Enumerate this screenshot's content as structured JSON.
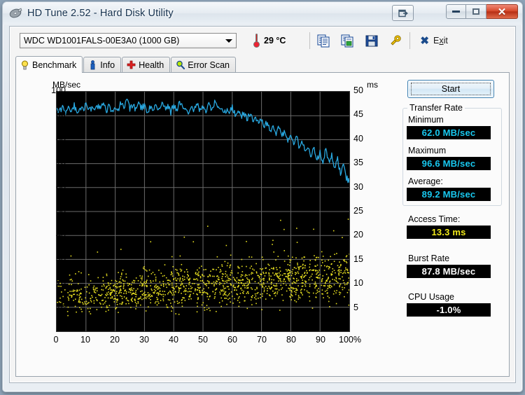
{
  "window": {
    "title": "HD Tune 2.52 - Hard Disk Utility",
    "app_icon": "hdtune-disk-icon",
    "buttons": {
      "restore_small": "restore-window-icon",
      "minimize": "minimize-icon",
      "maximize": "maximize-icon",
      "close": "✕"
    }
  },
  "toolbar": {
    "drive": {
      "selected": "WDC WD1001FALS-00E3A0 (1000 GB)",
      "options": [
        "WDC WD1001FALS-00E3A0 (1000 GB)"
      ]
    },
    "temperature": "29 °C",
    "icons": [
      {
        "name": "copy-text-icon"
      },
      {
        "name": "copy-image-icon"
      },
      {
        "name": "save-icon"
      },
      {
        "name": "options-icon"
      }
    ],
    "exit": {
      "label_before": "E",
      "label_underlined": "x",
      "label_after": "it",
      "full": "Exit"
    }
  },
  "tabs": [
    {
      "id": "benchmark",
      "label": "Benchmark",
      "icon": "bulb-icon",
      "active": true
    },
    {
      "id": "info",
      "label": "Info",
      "icon": "info-icon",
      "active": false
    },
    {
      "id": "health",
      "label": "Health",
      "icon": "health-cross-icon",
      "active": false
    },
    {
      "id": "errorscan",
      "label": "Error Scan",
      "icon": "magnifier-icon",
      "active": false
    }
  ],
  "side_panel": {
    "start_label": "Start",
    "transfer_rate": {
      "legend": "Transfer Rate",
      "minimum_label": "Minimum",
      "minimum_value": "62.0 MB/sec",
      "maximum_label": "Maximum",
      "maximum_value": "96.6 MB/sec",
      "average_label": "Average:",
      "average_value": "89.2 MB/sec"
    },
    "access_time_label": "Access Time:",
    "access_time_value": "13.3 ms",
    "burst_rate_label": "Burst Rate",
    "burst_rate_value": "87.8 MB/sec",
    "cpu_usage_label": "CPU Usage",
    "cpu_usage_value": "-1.0%"
  },
  "colors": {
    "transfer_curve": "#29a8e0",
    "access_points": "#e8e020",
    "plot_background": "#000000",
    "grid": "#6b6b6b",
    "lcd_cyan": "#18c8ef",
    "lcd_yellow": "#f2ea1a",
    "close_red": "#c0391a"
  },
  "chart_data": {
    "type": "line",
    "title": "",
    "xlabel": "100%",
    "ylabel": "MB/sec",
    "y2label": "ms",
    "xlim": [
      0,
      100
    ],
    "ylim": [
      0,
      100
    ],
    "y2lim": [
      0,
      50
    ],
    "grid": true,
    "legend": "none",
    "x_ticks": [
      "0",
      "10",
      "20",
      "30",
      "40",
      "50",
      "60",
      "70",
      "80",
      "90",
      "100%"
    ],
    "y_ticks_left": [
      "100",
      "90",
      "80",
      "70",
      "60",
      "50",
      "40",
      "30",
      "20",
      "10"
    ],
    "y_ticks_right": [
      "50",
      "45",
      "40",
      "35",
      "30",
      "25",
      "20",
      "15",
      "10",
      "5"
    ],
    "series": [
      {
        "name": "Transfer Rate",
        "axis": "left",
        "unit": "MB/sec",
        "color": "#29a8e0",
        "type": "line",
        "x": [
          0,
          1,
          2,
          3,
          4,
          5,
          6,
          7,
          8,
          9,
          10,
          11,
          12,
          13,
          14,
          15,
          16,
          17,
          18,
          19,
          20,
          21,
          22,
          23,
          24,
          25,
          26,
          27,
          28,
          29,
          30,
          31,
          32,
          33,
          34,
          35,
          36,
          37,
          38,
          39,
          40,
          41,
          42,
          43,
          44,
          45,
          46,
          47,
          48,
          49,
          50,
          51,
          52,
          53,
          54,
          55,
          56,
          57,
          58,
          59,
          60,
          61,
          62,
          63,
          64,
          65,
          66,
          67,
          68,
          69,
          70,
          71,
          72,
          73,
          74,
          75,
          76,
          77,
          78,
          79,
          80,
          81,
          82,
          83,
          84,
          85,
          86,
          87,
          88,
          89,
          90,
          91,
          92,
          93,
          94,
          95,
          96,
          97,
          98,
          99,
          100
        ],
        "values": [
          92.4,
          91.8,
          93.2,
          91.5,
          93.6,
          92.0,
          94.2,
          91.3,
          93.8,
          92.5,
          94.6,
          91.9,
          93.4,
          92.2,
          94.1,
          92.8,
          95.0,
          92.4,
          93.9,
          91.6,
          94.3,
          92.1,
          95.4,
          93.0,
          96.6,
          92.7,
          94.8,
          92.3,
          95.1,
          93.4,
          94.0,
          91.8,
          93.6,
          92.0,
          94.4,
          92.6,
          95.2,
          93.1,
          93.8,
          91.4,
          94.9,
          92.2,
          95.6,
          93.3,
          94.1,
          91.7,
          93.2,
          92.8,
          94.5,
          92.0,
          93.5,
          91.2,
          94.8,
          92.4,
          95.3,
          92.9,
          93.0,
          90.5,
          92.6,
          91.0,
          93.4,
          90.2,
          92.0,
          89.6,
          91.4,
          88.8,
          90.6,
          87.9,
          89.8,
          86.5,
          88.4,
          85.2,
          87.6,
          84.0,
          86.2,
          82.8,
          85.0,
          81.4,
          83.6,
          80.0,
          82.4,
          78.6,
          81.0,
          76.5,
          79.4,
          74.8,
          77.6,
          73.0,
          76.2,
          71.4,
          74.6,
          69.8,
          76.8,
          70.2,
          73.4,
          67.6,
          71.8,
          66.0,
          70.4,
          64.2,
          62.0
        ]
      },
      {
        "name": "Access Time",
        "axis": "right",
        "unit": "ms",
        "color": "#e8e020",
        "type": "scatter",
        "average_ms": 13.3,
        "range_ms": [
          3.5,
          22.0
        ],
        "description": "Dense yellow scatter cloud rising slowly from ~5-12 ms near 0% to ~11-18 ms near 100%, with sparse outliers up to ~22 ms"
      }
    ]
  }
}
